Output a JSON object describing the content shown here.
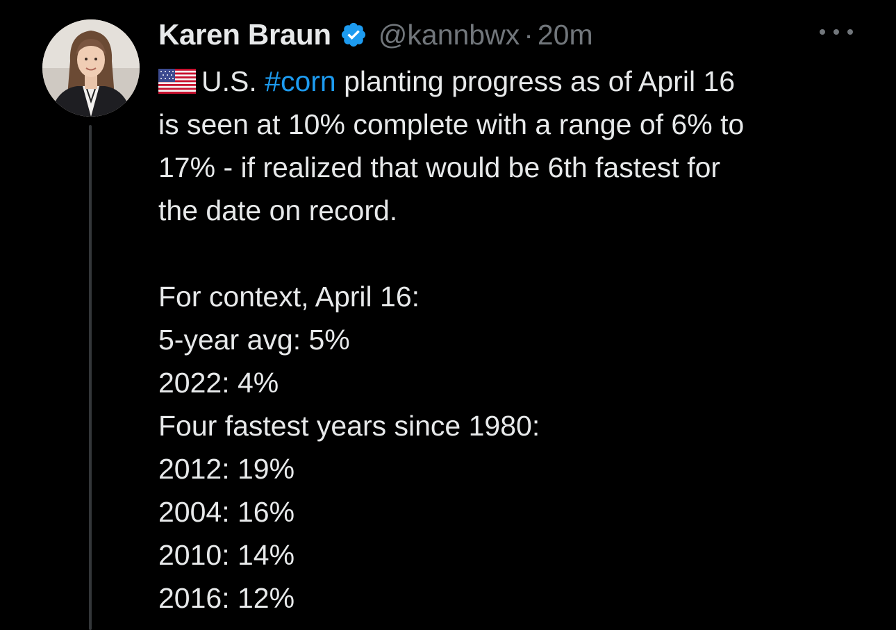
{
  "tweet": {
    "author": {
      "display_name": "Karen Braun",
      "handle": "@kannbwx",
      "verified": true
    },
    "separator": "·",
    "time": "20m",
    "text": {
      "line1_pre": "U.S. ",
      "hashtag": "#corn",
      "line1_post": " planting progress as of April 16",
      "line2": "is seen at 10% complete with a range of 6% to",
      "line3": "17% - if realized that would be 6th fastest for",
      "line4": "the date on record.",
      "context_heading": "For context, April 16:",
      "avg": "5-year avg: 5%",
      "y2022": "2022: 4%",
      "fastest_heading": "Four fastest years since 1980:",
      "fastest": [
        "2012: 19%",
        "2004: 16%",
        "2010: 14%",
        "2016: 12%"
      ]
    }
  },
  "colors": {
    "background": "#000000",
    "text": "#e7e9ea",
    "muted": "#71767b",
    "accent": "#1d9bf0"
  },
  "icons": {
    "verified": "verified-badge-icon",
    "flag": "us-flag-icon",
    "more": "more-options-icon"
  }
}
